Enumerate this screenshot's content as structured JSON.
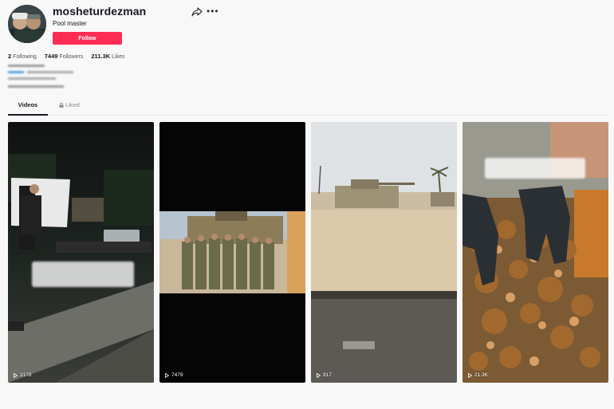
{
  "profile": {
    "username": "mosheturdezman",
    "subtitle": "Pool master",
    "follow_label": "Follow"
  },
  "stats": [
    {
      "value": "2",
      "label": "Following"
    },
    {
      "value": "7449",
      "label": "Followers"
    },
    {
      "value": "211.3K",
      "label": "Likes"
    }
  ],
  "tabs": [
    {
      "label": "Videos"
    },
    {
      "label": "Liked"
    }
  ],
  "videos": [
    {
      "views": "2178"
    },
    {
      "views": "7479"
    },
    {
      "views": "917"
    },
    {
      "views": "21.3K"
    }
  ],
  "colors": {
    "accent": "#fe2c55",
    "text": "#161823",
    "background": "#f8f8f8"
  }
}
